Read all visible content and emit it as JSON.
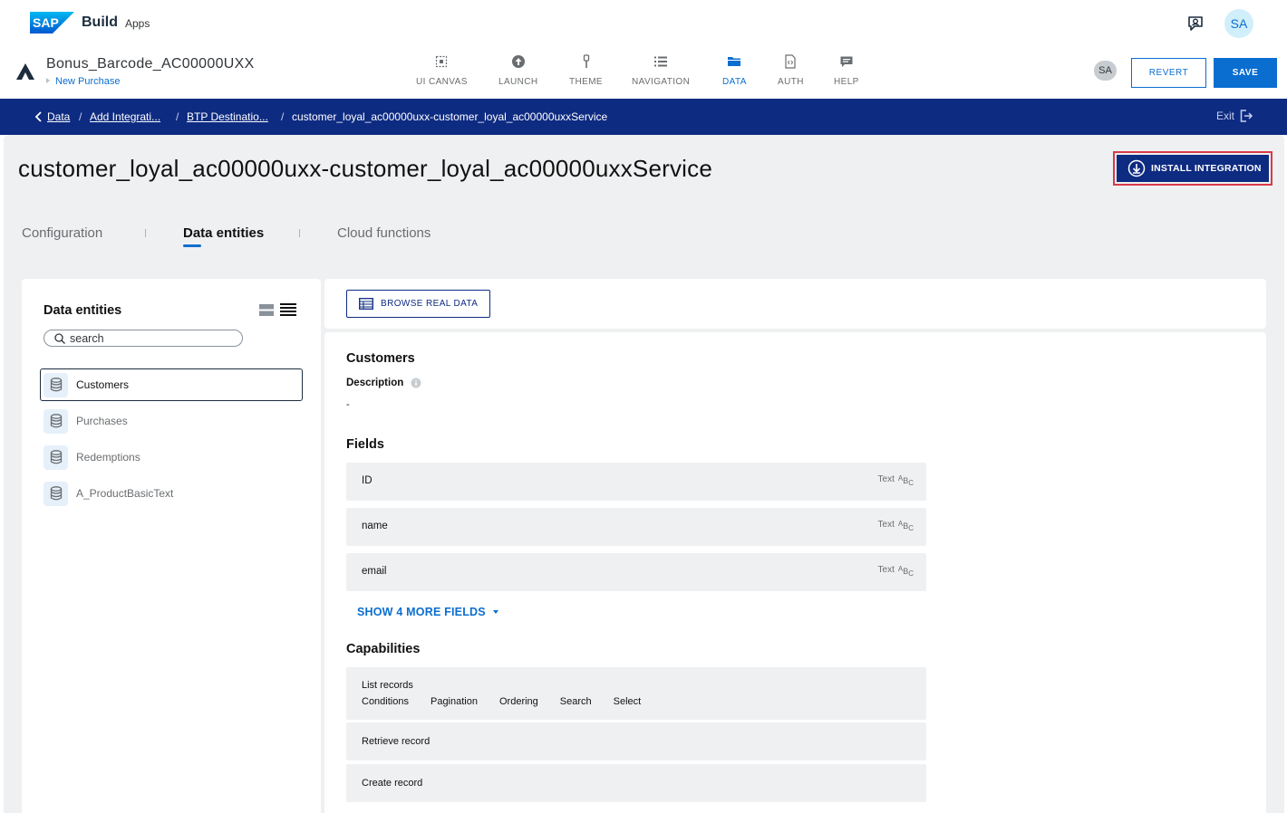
{
  "shell": {
    "logo_text": "SAP",
    "product": "Build",
    "subproduct": "Apps",
    "avatar": "SA"
  },
  "app": {
    "title": "Bonus_Barcode_AC00000UXX",
    "page": "New Purchase",
    "nav": [
      {
        "label": "UI CANVAS",
        "icon": "ui-canvas-icon"
      },
      {
        "label": "LAUNCH",
        "icon": "launch-icon"
      },
      {
        "label": "THEME",
        "icon": "theme-icon"
      },
      {
        "label": "NAVIGATION",
        "icon": "navigation-icon"
      },
      {
        "label": "DATA",
        "icon": "data-folder-icon"
      },
      {
        "label": "AUTH",
        "icon": "auth-icon"
      },
      {
        "label": "HELP",
        "icon": "help-icon"
      }
    ],
    "active_nav": "DATA",
    "user_badge": "SA",
    "revert_label": "REVERT",
    "save_label": "SAVE"
  },
  "breadcrumb": {
    "items": [
      "Data",
      "Add Integrati...",
      "BTP Destinatio...",
      "customer_loyal_ac00000uxx-customer_loyal_ac00000uxxService"
    ],
    "exit_label": "Exit"
  },
  "page": {
    "title": "customer_loyal_ac00000uxx-customer_loyal_ac00000uxxService",
    "install_label": "INSTALL INTEGRATION",
    "tabs": [
      "Configuration",
      "Data entities",
      "Cloud functions"
    ],
    "active_tab": "Data entities"
  },
  "entities_panel": {
    "title": "Data entities",
    "search_placeholder": "search",
    "items": [
      "Customers",
      "Purchases",
      "Redemptions",
      "A_ProductBasicText"
    ],
    "selected": "Customers"
  },
  "detail": {
    "browse_label": "BROWSE REAL DATA",
    "entity_name": "Customers",
    "description_label": "Description",
    "description_value": "-",
    "fields_heading": "Fields",
    "fields": [
      {
        "name": "ID",
        "type": "Text"
      },
      {
        "name": "name",
        "type": "Text"
      },
      {
        "name": "email",
        "type": "Text"
      }
    ],
    "type_glyph": {
      "a": "A",
      "b": "B",
      "c": "C"
    },
    "show_more_label": "SHOW 4 MORE FIELDS",
    "capabilities_heading": "Capabilities",
    "capabilities": [
      {
        "name": "List records",
        "options": [
          "Conditions",
          "Pagination",
          "Ordering",
          "Search",
          "Select"
        ]
      },
      {
        "name": "Retrieve record"
      },
      {
        "name": "Create record"
      }
    ]
  },
  "colors": {
    "brand_blue": "#0a6ed1",
    "header_navy": "#0e2b82",
    "highlight_red": "#d93a4a",
    "panel_bg": "#eff0f1"
  }
}
